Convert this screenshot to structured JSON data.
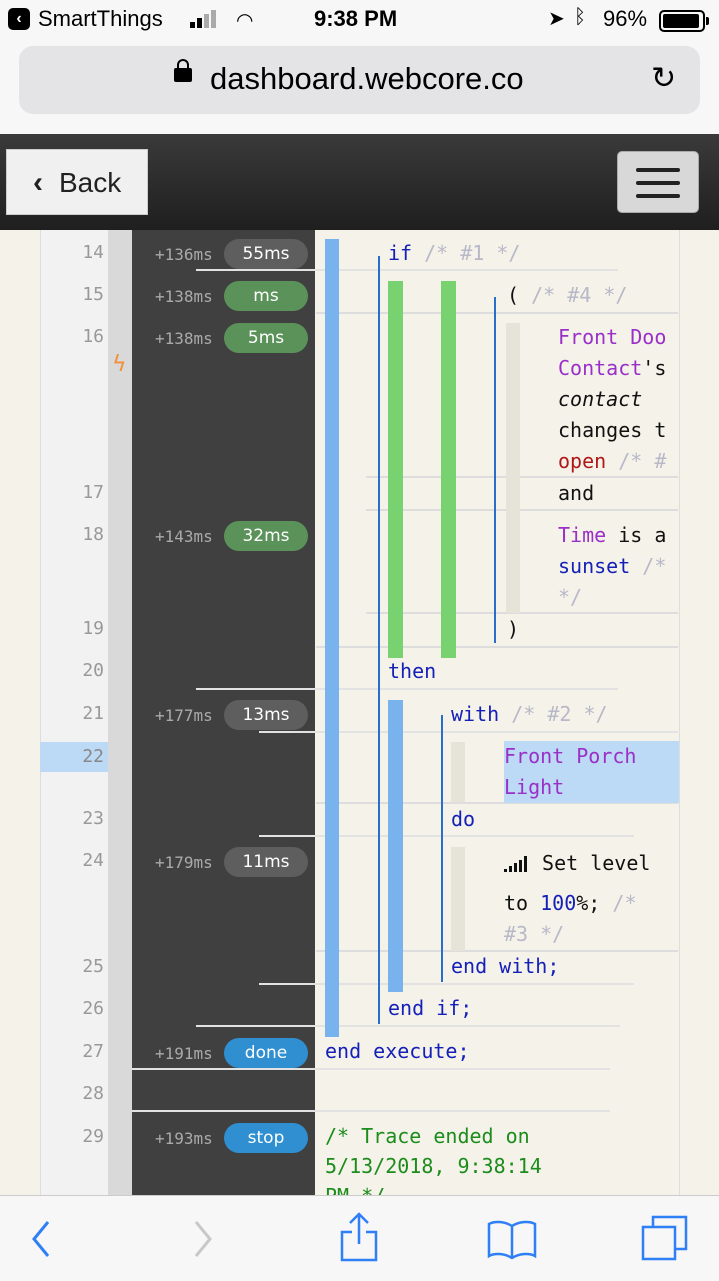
{
  "status_bar": {
    "app_name": "SmartThings",
    "time": "9:38 PM",
    "battery": "96%"
  },
  "browser": {
    "url": "dashboard.webcore.co"
  },
  "nav": {
    "back_label": "Back"
  },
  "trace": {
    "lines": [
      {
        "num": "14",
        "time": "+136ms",
        "badge": "55ms",
        "badge_color": "#5e5e5e"
      },
      {
        "num": "15",
        "time": "+138ms",
        "badge": "ms",
        "badge_color": "#5a925a"
      },
      {
        "num": "16",
        "time": "+138ms",
        "badge": "5ms",
        "badge_color": "#5a925a"
      },
      {
        "num": "17"
      },
      {
        "num": "18",
        "time": "+143ms",
        "badge": "32ms",
        "badge_color": "#5a925a"
      },
      {
        "num": "19"
      },
      {
        "num": "20"
      },
      {
        "num": "21",
        "time": "+177ms",
        "badge": "13ms",
        "badge_color": "#5e5e5e"
      },
      {
        "num": "22"
      },
      {
        "num": "23"
      },
      {
        "num": "24",
        "time": "+179ms",
        "badge": "11ms",
        "badge_color": "#5e5e5e"
      },
      {
        "num": "25"
      },
      {
        "num": "26"
      },
      {
        "num": "27",
        "time": "+191ms",
        "badge": "done",
        "badge_color": "#2f8fd0"
      },
      {
        "num": "28"
      },
      {
        "num": "29",
        "time": "+193ms",
        "badge": "stop",
        "badge_color": "#2f8fd0"
      }
    ],
    "code": {
      "if_kw": "if",
      "if_comment": "/* #1 */",
      "paren_open": "(",
      "paren_comment": "/* #4 */",
      "device_front_door": "Front Doo",
      "contact_s": "Contact",
      "apostrophe_s": "'s",
      "attr_contact": "contact",
      "changes_to": "changes t",
      "value_open": "open",
      "open_comment": "/* #",
      "and_kw": "and",
      "time_word": "Time",
      "is_a": "is a",
      "sunset": "sunset",
      "sunset_comment": "/*",
      "comment_close": "*/",
      "paren_close": ")",
      "then_kw": "then",
      "with_kw": "with",
      "with_comment": "/* #2 */",
      "device_porch_1": "Front Porch",
      "device_porch_2": "Light",
      "do_kw": "do",
      "set_level": "Set level",
      "to_word": "to",
      "level_value": "100",
      "percent_semicolon": "%;",
      "level_comment_a": "/*",
      "level_comment_b": "#3 */",
      "end_with": "end with;",
      "end_if": "end if;",
      "end_execute": "end execute;",
      "trace_end_1": "/* Trace ended on",
      "trace_end_2": "5/13/2018, 9:38:14",
      "trace_end_3": "PM */"
    }
  }
}
